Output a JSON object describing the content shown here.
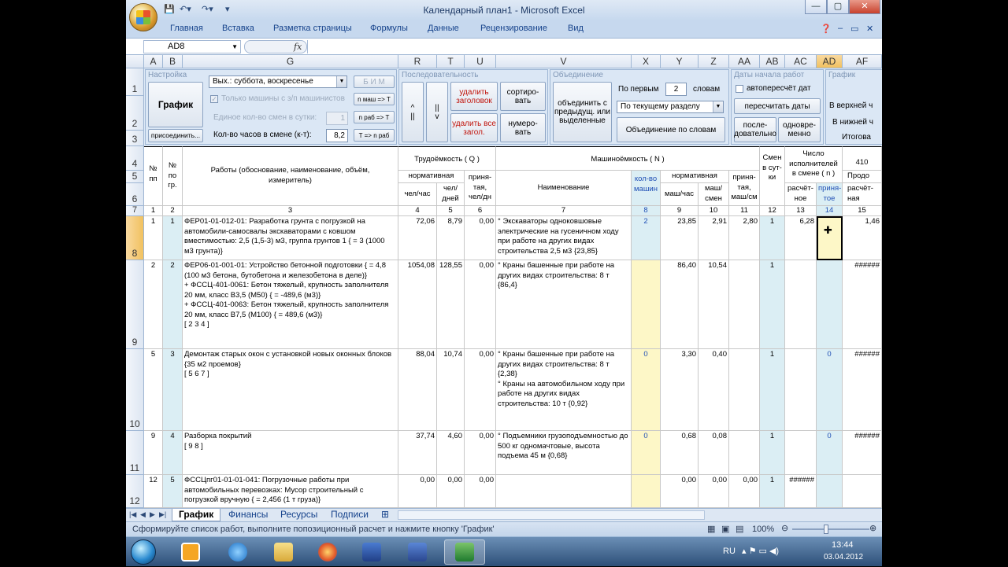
{
  "window": {
    "title": "Календарный план1 - Microsoft Excel",
    "buttons": [
      "—",
      "▢",
      "✕"
    ]
  },
  "ribbon_tabs": [
    "Главная",
    "Вставка",
    "Разметка страницы",
    "Формулы",
    "Данные",
    "Рецензирование",
    "Вид"
  ],
  "formula_bar": {
    "name_box": "AD8",
    "fx": "fx",
    "value": ""
  },
  "columns": [
    "A",
    "B",
    "G",
    "R",
    "T",
    "U",
    "V",
    "X",
    "Y",
    "Z",
    "AA",
    "AB",
    "AC",
    "AD",
    "AF"
  ],
  "selected_column": "AD",
  "panels": {
    "settings": {
      "title": "Настройка",
      "graph_button": "График",
      "attach_button": "присоединить...",
      "days_off": "Вых.: суббота, воскресенье",
      "bim_button": "Б И М",
      "only_machines": "Только машины с з/п машинистов",
      "single_shifts_label": "Единое кол-во смен в сутки:",
      "single_shifts_value": "1",
      "hours_label": "Кол-во часов в смене (к-т):",
      "hours_value": "8,2",
      "btn_n_mash": "n маш => T",
      "btn_n_rab": "n раб => T",
      "btn_t_rab": "T => n раб"
    },
    "sequence": {
      "title": "Последовательность",
      "up_arrow": "^",
      "parallel": "||",
      "down_arrow": "v",
      "delete_headers": "удалить заголовок",
      "delete_all_headers": "удалить все загол.",
      "sort": "сортиро- вать",
      "number": "нумеро- вать"
    },
    "merge": {
      "title": "Объединение",
      "merge_button": "объединить с предыдущ. или выделенные",
      "by_first": "По первым",
      "by_first_value": "2",
      "words": "словам",
      "by_section": "По текущему разделу",
      "merge_words": "Объединение по словам"
    },
    "dates": {
      "title": "Даты начала работ",
      "auto_recalc": "автопересчёт дат",
      "recalc_button": "пересчитать даты",
      "sequential": "после- довательно",
      "simultaneous": "одновре- менно"
    },
    "graph": {
      "title": "График",
      "top": "В верхней ч",
      "bottom": "В нижней ч",
      "total": "Итогова"
    }
  },
  "row_numbers": [
    "1",
    "2",
    "3",
    "4",
    "5",
    "6",
    "7",
    "8",
    "9",
    "10",
    "11",
    "12"
  ],
  "table_header": {
    "num": "№ пп",
    "num_gr": "№ по гр.",
    "works": "Работы (обоснование, наименование, объём, измеритель)",
    "labor": "Трудоёмкость ( Q )",
    "normative": "нормативная",
    "chel_chas": "чел/час",
    "chel_dney": "чел/ дней",
    "accepted_chel": "приня- тая, чел/дн",
    "machine_hours": "Машиноёмкость ( N )",
    "name": "Наименование",
    "count_machines": "кол-во машин",
    "mash_chas": "маш/час",
    "mash_smen": "маш/ смен",
    "accepted_mash": "приня- тая, маш/см",
    "shifts": "Смен в сут- ки",
    "workers": "Число исполнителей в смене ( n )",
    "calc": "расчёт- ное",
    "accepted": "приня- тое",
    "col_410": "410",
    "prod": "Продо",
    "calc2": "расчёт- ная",
    "numbers": [
      "1",
      "2",
      "3",
      "4",
      "5",
      "6",
      "7",
      "8",
      "9",
      "10",
      "11",
      "12",
      "13",
      "14",
      "15"
    ]
  },
  "rows": [
    {
      "n": "1",
      "gr": "1",
      "work": "ФЕР01-01-012-01: Разработка грунта с погрузкой на автомобили-самосвалы экскаваторами с ковшом вместимостью: 2,5 (1,5-3) м3, группа грунтов 1 { = 3 (1000 м3 грунта)}",
      "q1": "72,06",
      "q2": "8,79",
      "q3": "0,00",
      "name": "° Экскаваторы одноковшовые электрические на гусеничном ходу при работе на других видах строительства 2,5 м3 {23,85}",
      "cnt": "2",
      "m1": "23,85",
      "m2": "2,91",
      "m3": "2,80",
      "sh": "1",
      "calc": "6,28",
      "acc": "",
      "p": "1,46"
    },
    {
      "n": "2",
      "gr": "2",
      "work": "ФЕР06-01-001-01: Устройство бетонной подготовки { = 4,8 (100 м3 бетона, бутобетона и железобетона в деле)}\n+ ФССЦ-401-0061: Бетон тяжелый, крупность заполнителя 20 мм, класс В3,5 (М50) { = -489,6 (м3)}\n+ ФССЦ-401-0063: Бетон тяжелый, крупность заполнителя 20 мм, класс В7,5 (М100) { = 489,6 (м3)}\n[ 2 3 4 ]",
      "q1": "1054,08",
      "q2": "128,55",
      "q3": "0,00",
      "name": "° Краны башенные при работе на других видах строительства: 8 т {86,4}",
      "cnt": "",
      "m1": "86,40",
      "m2": "10,54",
      "m3": "",
      "sh": "1",
      "calc": "",
      "acc": "",
      "p": "######"
    },
    {
      "n": "5",
      "gr": "3",
      "work": "Демонтаж старых окон с установкой новых оконных блоков {35 м2 проемов}\n[ 5 6 7 ]",
      "q1": "88,04",
      "q2": "10,74",
      "q3": "0,00",
      "name": "° Краны башенные при работе на других видах строительства: 8 т {2,38}\n° Краны на автомобильном ходу при работе на других видах строительства: 10 т {0,92}",
      "cnt": "0",
      "m1": "3,30",
      "m2": "0,40",
      "m3": "",
      "sh": "1",
      "calc": "",
      "acc": "0",
      "p": "######"
    },
    {
      "n": "9",
      "gr": "4",
      "work": "Разборка покрытий\n[ 9 8 ]",
      "q1": "37,74",
      "q2": "4,60",
      "q3": "0,00",
      "name": "° Подъемники грузоподъемностью до 500 кг одномачтовые, высота подъема 45 м {0,68}",
      "cnt": "0",
      "m1": "0,68",
      "m2": "0,08",
      "m3": "",
      "sh": "1",
      "calc": "",
      "acc": "0",
      "p": "######"
    },
    {
      "n": "12",
      "gr": "5",
      "work": "ФССЦпг01-01-01-041: Погрузочные работы при автомобильных перевозках: Мусор строительный с погрузкой вручную { = 2,456 (1 т груза)}",
      "q1": "0,00",
      "q2": "0,00",
      "q3": "0,00",
      "name": "",
      "cnt": "",
      "m1": "0,00",
      "m2": "0,00",
      "m3": "0,00",
      "sh": "1",
      "calc": "######",
      "acc": "",
      "p": ""
    }
  ],
  "sheet_tabs": [
    "График",
    "Финансы",
    "Ресурсы",
    "Подписи"
  ],
  "status": {
    "message": "Сформируйте список работ, выполните попозиционный расчет и нажмите кнопку 'График'",
    "zoom": "100%"
  },
  "taskbar": {
    "lang": "RU",
    "time": "13:44",
    "date": "03.04.2012"
  }
}
